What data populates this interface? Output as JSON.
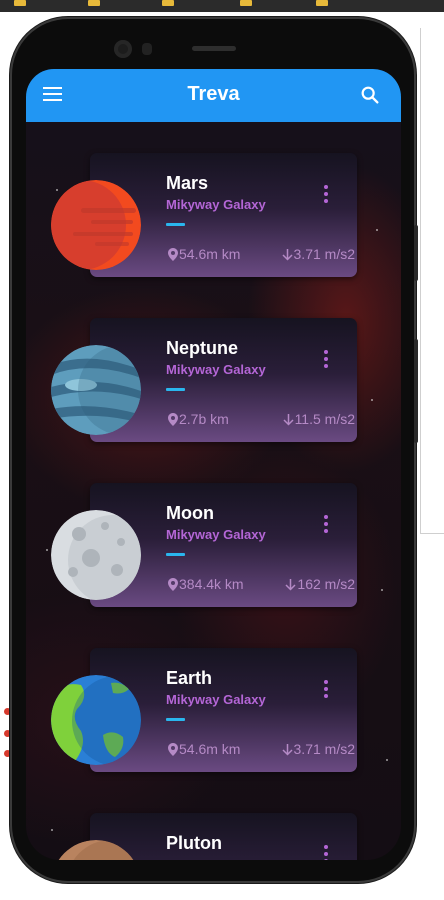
{
  "app": {
    "title": "Treva",
    "menu_icon": "menu-icon",
    "search_icon": "search-icon",
    "accent_color": "#2196f3",
    "galaxy_color": "#b466d6",
    "divider_color": "#2ab6ee"
  },
  "planets": [
    {
      "name": "Mars",
      "galaxy": "Mikyway Galaxy",
      "distance": "54.6m km",
      "gravity": "3.71 m/s2",
      "planet_icon": "mars-planet-icon"
    },
    {
      "name": "Neptune",
      "galaxy": "Mikyway Galaxy",
      "distance": "2.7b km",
      "gravity": "11.5 m/s2",
      "planet_icon": "neptune-planet-icon"
    },
    {
      "name": "Moon",
      "galaxy": "Mikyway Galaxy",
      "distance": "384.4k km",
      "gravity": "162 m/s2",
      "planet_icon": "moon-planet-icon"
    },
    {
      "name": "Earth",
      "galaxy": "Mikyway Galaxy",
      "distance": "54.6m km",
      "gravity": "3.71 m/s2",
      "planet_icon": "earth-planet-icon"
    },
    {
      "name": "Pluton",
      "planet_icon": "pluton-planet-icon"
    }
  ]
}
